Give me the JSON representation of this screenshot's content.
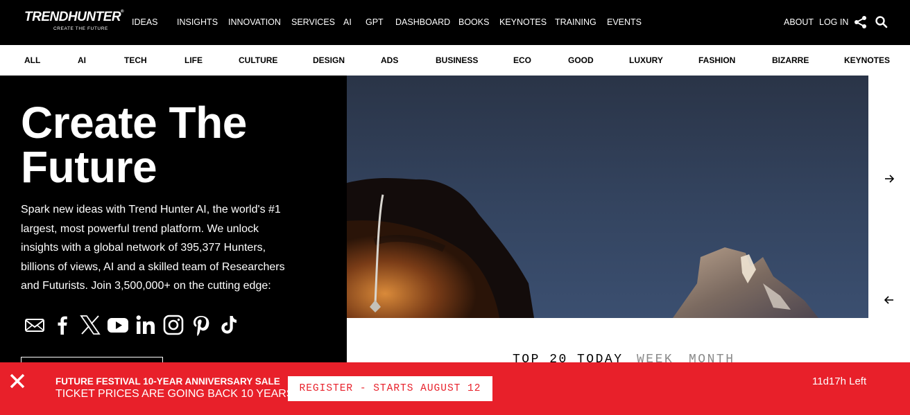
{
  "brand": {
    "name": "TRENDHUNTER",
    "tagline": "CREATE THE FUTURE"
  },
  "nav": {
    "items": [
      "IDEAS",
      "INSIGHTS",
      "INNOVATION",
      "SERVICES",
      "AI",
      "GPT",
      "DASHBOARD",
      "BOOKS",
      "KEYNOTES",
      "TRAINING",
      "EVENTS"
    ],
    "right": [
      "ABOUT",
      "LOG IN"
    ],
    "icons": [
      "share-icon",
      "search-icon"
    ]
  },
  "categories": [
    "ALL",
    "AI",
    "TECH",
    "LIFE",
    "CULTURE",
    "DESIGN",
    "ADS",
    "BUSINESS",
    "ECO",
    "GOOD",
    "LUXURY",
    "FASHION",
    "BIZARRE",
    "KEYNOTES"
  ],
  "hero": {
    "title": "Create The Future",
    "body": "Spark new ideas with Trend Hunter AI, the world's #1 largest, most powerful trend platform. We unlock insights with a global network of 395,377 Hunters, billions of views, AI and a skilled team of Researchers and Futurists. Join 3,500,000+ on the cutting edge:",
    "social_icons": [
      "email-icon",
      "facebook-icon",
      "x-icon",
      "youtube-icon",
      "linkedin-icon",
      "instagram-icon",
      "pinterest-icon",
      "tiktok-icon"
    ]
  },
  "top20": {
    "label": "TOP 20",
    "tabs": [
      "TODAY",
      "WEEK",
      "MONTH"
    ],
    "active": "TODAY"
  },
  "banner": {
    "line1": "FUTURE FESTIVAL 10-YEAR ANNIVERSARY SALE",
    "line2": "TICKET PRICES ARE GOING BACK 10 YEARS",
    "button": "REGISTER - STARTS AUGUST 12",
    "timer": "11d17h Left"
  },
  "colors": {
    "banner": "#e8202a",
    "top_bar": "#000000",
    "inactive_tab": "#8a8a8a"
  }
}
